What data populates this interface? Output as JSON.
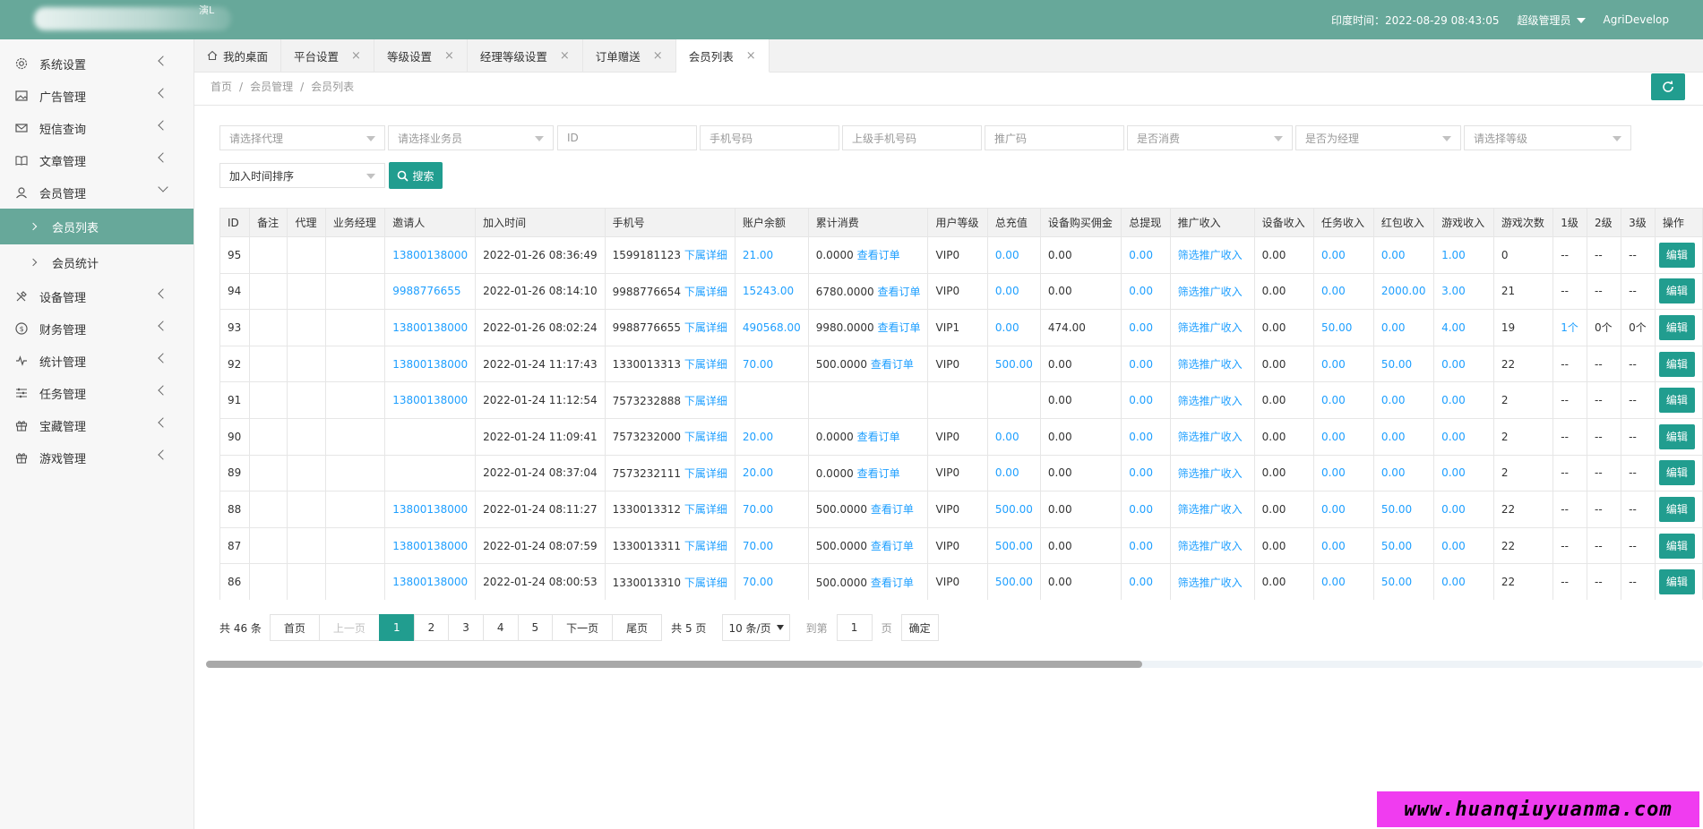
{
  "header": {
    "time_label": "印度时间：2022-08-29 08:43:05",
    "user_role": "超级管理员",
    "username": "AgriDevelop",
    "logo_text": "演L"
  },
  "sidebar": {
    "items": [
      {
        "label": "系统设置",
        "icon": "gear-icon"
      },
      {
        "label": "广告管理",
        "icon": "image-icon"
      },
      {
        "label": "短信查询",
        "icon": "mail-icon"
      },
      {
        "label": "文章管理",
        "icon": "book-icon"
      },
      {
        "label": "会员管理",
        "icon": "user-icon"
      },
      {
        "label": "设备管理",
        "icon": "tools-icon"
      },
      {
        "label": "财务管理",
        "icon": "dollar-icon"
      },
      {
        "label": "统计管理",
        "icon": "pulse-icon"
      },
      {
        "label": "任务管理",
        "icon": "sliders-icon"
      },
      {
        "label": "宝藏管理",
        "icon": "gift-icon"
      },
      {
        "label": "游戏管理",
        "icon": "gift-icon"
      }
    ],
    "sub_items": [
      {
        "label": "会员列表"
      },
      {
        "label": "会员统计"
      }
    ]
  },
  "tabs": [
    {
      "label": "我的桌面"
    },
    {
      "label": "平台设置"
    },
    {
      "label": "等级设置"
    },
    {
      "label": "经理等级设置"
    },
    {
      "label": "订单赠送"
    },
    {
      "label": "会员列表"
    }
  ],
  "breadcrumb": [
    "首页",
    "会员管理",
    "会员列表"
  ],
  "filters": {
    "agent": "请选择代理",
    "salesman": "请选择业务员",
    "id": "ID",
    "phone": "手机号码",
    "parent_phone": "上级手机号码",
    "promo_code": "推广码",
    "consumed": "是否消费",
    "manager": "是否为经理",
    "level": "请选择等级",
    "sort": "加入时间排序",
    "search_label": "搜索"
  },
  "table": {
    "headers": [
      "ID",
      "备注",
      "代理",
      "业务经理",
      "邀请人",
      "加入时间",
      "手机号",
      "账户余额",
      "累计消费",
      "用户等级",
      "总充值",
      "设备购买佣金",
      "总提现",
      "推广收入",
      "设备收入",
      "任务收入",
      "红包收入",
      "游戏收入",
      "游戏次数",
      "1级",
      "2级",
      "3级",
      "操作"
    ],
    "rows": [
      {
        "id": "95",
        "inviter": "13800138000",
        "time": "2022-01-26 08:36:49",
        "phone": "1599181123",
        "sub": "下属详细",
        "balance": "21.00",
        "spend": "0.0000",
        "order": "查看订单",
        "level": "VIP0",
        "recharge": "0.00",
        "device_comm": "0.00",
        "withdraw": "0.00",
        "promo": "筛选推广收入",
        "device_inc": "0.00",
        "task_inc": "0.00",
        "red_inc": "0.00",
        "game_inc": "1.00",
        "game_cnt": "0",
        "l1": "--",
        "l2": "--",
        "l3": "--",
        "op": "编辑"
      },
      {
        "id": "94",
        "inviter": "9988776655",
        "time": "2022-01-26 08:14:10",
        "phone": "9988776654",
        "sub": "下属详细",
        "balance": "15243.00",
        "spend": "6780.0000",
        "order": "查看订单",
        "level": "VIP0",
        "recharge": "0.00",
        "device_comm": "0.00",
        "withdraw": "0.00",
        "promo": "筛选推广收入",
        "device_inc": "0.00",
        "task_inc": "0.00",
        "red_inc": "2000.00",
        "game_inc": "3.00",
        "game_cnt": "21",
        "l1": "--",
        "l2": "--",
        "l3": "--",
        "op": "编辑"
      },
      {
        "id": "93",
        "inviter": "13800138000",
        "time": "2022-01-26 08:02:24",
        "phone": "9988776655",
        "sub": "下属详细",
        "balance": "490568.00",
        "spend": "9980.0000",
        "order": "查看订单",
        "level": "VIP1",
        "recharge": "0.00",
        "device_comm": "474.00",
        "withdraw": "0.00",
        "promo": "筛选推广收入",
        "device_inc": "0.00",
        "task_inc": "50.00",
        "red_inc": "0.00",
        "game_inc": "4.00",
        "game_cnt": "19",
        "l1": "1个",
        "l2": "0个",
        "l3": "0个",
        "op": "编辑"
      },
      {
        "id": "92",
        "inviter": "13800138000",
        "time": "2022-01-24 11:17:43",
        "phone": "1330013313",
        "sub": "下属详细",
        "balance": "70.00",
        "spend": "500.0000",
        "order": "查看订单",
        "level": "VIP0",
        "recharge": "500.00",
        "device_comm": "0.00",
        "withdraw": "0.00",
        "promo": "筛选推广收入",
        "device_inc": "0.00",
        "task_inc": "0.00",
        "red_inc": "50.00",
        "game_inc": "0.00",
        "game_cnt": "22",
        "l1": "--",
        "l2": "--",
        "l3": "--",
        "op": "编辑"
      },
      {
        "id": "91",
        "inviter": "13800138000",
        "time": "2022-01-24 11:12:54",
        "phone": "7573232888",
        "sub": "下属详细",
        "balance": "",
        "spend": "",
        "order": "",
        "level": "",
        "recharge": "",
        "device_comm": "0.00",
        "withdraw": "0.00",
        "promo": "筛选推广收入",
        "device_inc": "0.00",
        "task_inc": "0.00",
        "red_inc": "0.00",
        "game_inc": "0.00",
        "game_cnt": "2",
        "l1": "--",
        "l2": "--",
        "l3": "--",
        "op": "编辑"
      },
      {
        "id": "90",
        "inviter": "",
        "time": "2022-01-24 11:09:41",
        "phone": "7573232000",
        "sub": "下属详细",
        "balance": "20.00",
        "spend": "0.0000",
        "order": "查看订单",
        "level": "VIP0",
        "recharge": "0.00",
        "device_comm": "0.00",
        "withdraw": "0.00",
        "promo": "筛选推广收入",
        "device_inc": "0.00",
        "task_inc": "0.00",
        "red_inc": "0.00",
        "game_inc": "0.00",
        "game_cnt": "2",
        "l1": "--",
        "l2": "--",
        "l3": "--",
        "op": "编辑"
      },
      {
        "id": "89",
        "inviter": "",
        "time": "2022-01-24 08:37:04",
        "phone": "7573232111",
        "sub": "下属详细",
        "balance": "20.00",
        "spend": "0.0000",
        "order": "查看订单",
        "level": "VIP0",
        "recharge": "0.00",
        "device_comm": "0.00",
        "withdraw": "0.00",
        "promo": "筛选推广收入",
        "device_inc": "0.00",
        "task_inc": "0.00",
        "red_inc": "0.00",
        "game_inc": "0.00",
        "game_cnt": "2",
        "l1": "--",
        "l2": "--",
        "l3": "--",
        "op": "编辑"
      },
      {
        "id": "88",
        "inviter": "13800138000",
        "time": "2022-01-24 08:11:27",
        "phone": "1330013312",
        "sub": "下属详细",
        "balance": "70.00",
        "spend": "500.0000",
        "order": "查看订单",
        "level": "VIP0",
        "recharge": "500.00",
        "device_comm": "0.00",
        "withdraw": "0.00",
        "promo": "筛选推广收入",
        "device_inc": "0.00",
        "task_inc": "0.00",
        "red_inc": "50.00",
        "game_inc": "0.00",
        "game_cnt": "22",
        "l1": "--",
        "l2": "--",
        "l3": "--",
        "op": "编辑"
      },
      {
        "id": "87",
        "inviter": "13800138000",
        "time": "2022-01-24 08:07:59",
        "phone": "1330013311",
        "sub": "下属详细",
        "balance": "70.00",
        "spend": "500.0000",
        "order": "查看订单",
        "level": "VIP0",
        "recharge": "500.00",
        "device_comm": "0.00",
        "withdraw": "0.00",
        "promo": "筛选推广收入",
        "device_inc": "0.00",
        "task_inc": "0.00",
        "red_inc": "50.00",
        "game_inc": "0.00",
        "game_cnt": "22",
        "l1": "--",
        "l2": "--",
        "l3": "--",
        "op": "编辑"
      },
      {
        "id": "86",
        "inviter": "13800138000",
        "time": "2022-01-24 08:00:53",
        "phone": "1330013310",
        "sub": "下属详细",
        "balance": "70.00",
        "spend": "500.0000",
        "order": "查看订单",
        "level": "VIP0",
        "recharge": "500.00",
        "device_comm": "0.00",
        "withdraw": "0.00",
        "promo": "筛选推广收入",
        "device_inc": "0.00",
        "task_inc": "0.00",
        "red_inc": "50.00",
        "game_inc": "0.00",
        "game_cnt": "22",
        "l1": "--",
        "l2": "--",
        "l3": "--",
        "op": "编辑"
      }
    ]
  },
  "pager": {
    "total": "共 46 条",
    "first": "首页",
    "prev": "上一页",
    "pages": [
      "1",
      "2",
      "3",
      "4",
      "5"
    ],
    "current": "1",
    "next": "下一页",
    "last": "尾页",
    "page_count": "共 5 页",
    "per_page": "10 条/页",
    "goto_label": "到第",
    "goto_value": "1",
    "page_unit": "页",
    "confirm": "确定"
  },
  "watermark": "www.huanqiuyuanma.com",
  "colors": {
    "header": "#67a89a",
    "accent": "#219d8f",
    "link": "#1e9fff",
    "watermark_bg": "#f03cf0"
  }
}
